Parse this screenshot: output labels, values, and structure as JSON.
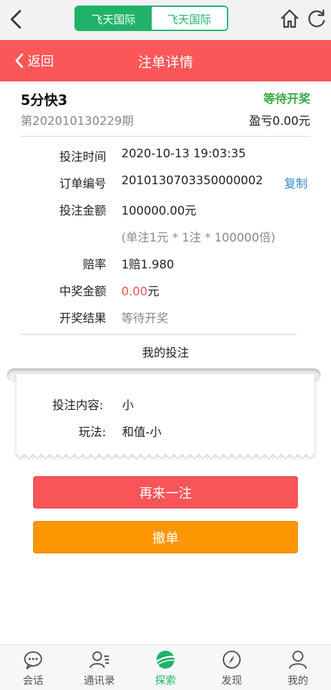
{
  "topbar": {
    "segments": [
      "飞天国际",
      "飞天国际"
    ],
    "icons": [
      "back-chevron-icon",
      "home-icon",
      "refresh-icon"
    ]
  },
  "header": {
    "back_label": "返回",
    "title": "注单详情"
  },
  "summary": {
    "game_name": "5分快3",
    "status": "等待开奖",
    "issue": "第202010130229期",
    "profit": "盈亏0.00元"
  },
  "details": {
    "bet_time_label": "投注时间",
    "bet_time": "2020-10-13 19:03:35",
    "order_no_label": "订单编号",
    "order_no": "2010130703350000002",
    "copy_label": "复制",
    "amount_label": "投注金额",
    "amount": "100000.00元",
    "amount_note": "(单注1元 * 1注 * 100000倍)",
    "odds_label": "赔率",
    "odds": "1赔1.980",
    "win_label": "中奖金额",
    "win_amount": "0.00",
    "win_unit": "元",
    "result_label": "开奖结果",
    "result": "等待开奖"
  },
  "my_bet": {
    "title": "我的投注",
    "content_label": "投注内容:",
    "content": "小",
    "play_label": "玩法:",
    "play": "和值-小"
  },
  "buttons": {
    "again": "再来一注",
    "cancel": "撤单"
  },
  "tabs": [
    {
      "label": "会话",
      "icon": "chat-icon",
      "active": false
    },
    {
      "label": "通讯录",
      "icon": "contacts-icon",
      "active": false
    },
    {
      "label": "探索",
      "icon": "planet-icon",
      "active": true
    },
    {
      "label": "发现",
      "icon": "compass-icon",
      "active": false
    },
    {
      "label": "我的",
      "icon": "user-icon",
      "active": false
    }
  ],
  "colors": {
    "accent_green": "#1fb36a",
    "header_red": "#fb5759",
    "button_red": "#f95458",
    "button_orange": "#fd9600",
    "status_green": "#3aa845",
    "link_blue": "#2f8dd4"
  }
}
